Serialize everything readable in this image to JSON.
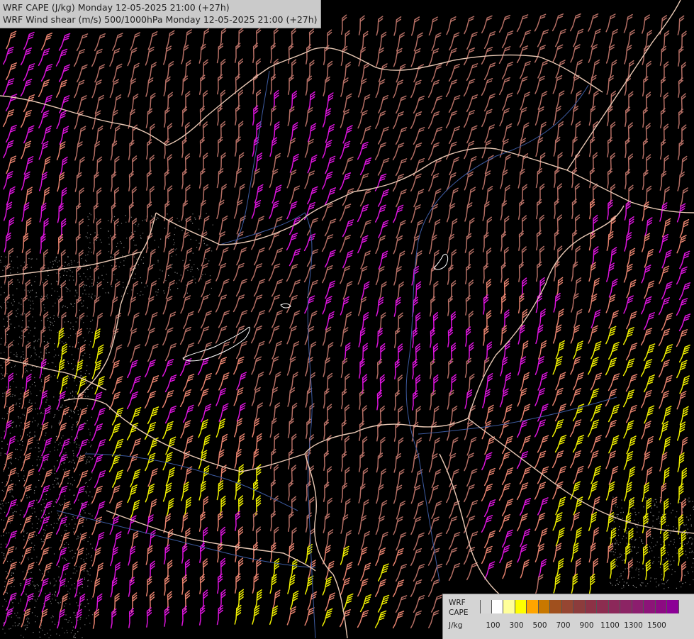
{
  "titles": {
    "line1": "WRF CAPE (J/kg) Monday 12-05-2025 21:00 (+27h)",
    "line2": "WRF Wind shear (m/s) 500/1000hPa Monday 12-05-2025 21:00 (+27h)"
  },
  "legend": {
    "model": "WRF",
    "variable": "CAPE",
    "unit": "J/kg",
    "tick_labels": [
      "100",
      "300",
      "500",
      "700",
      "900",
      "1100",
      "1300",
      "1500"
    ],
    "colors": [
      "#d8d8d8",
      "#ffffff",
      "#ffff9a",
      "#ffff00",
      "#ffa500",
      "#c87800",
      "#a0501e",
      "#964632",
      "#8c3c3c",
      "#8c3246",
      "#8c2d50",
      "#8c285a",
      "#8c2464",
      "#8c1e6e",
      "#8c1478",
      "#8c0a82",
      "#8c0096"
    ]
  },
  "map_colors": {
    "background": "#000000",
    "country_border": "#e8c8b4",
    "river": "#3c5aa0",
    "lake": "#ffffff",
    "barb_low": "#b46e64",
    "barb_mid": "#e6826e",
    "barb_high": "#dc14dc",
    "barb_extreme": "#f0f000"
  }
}
